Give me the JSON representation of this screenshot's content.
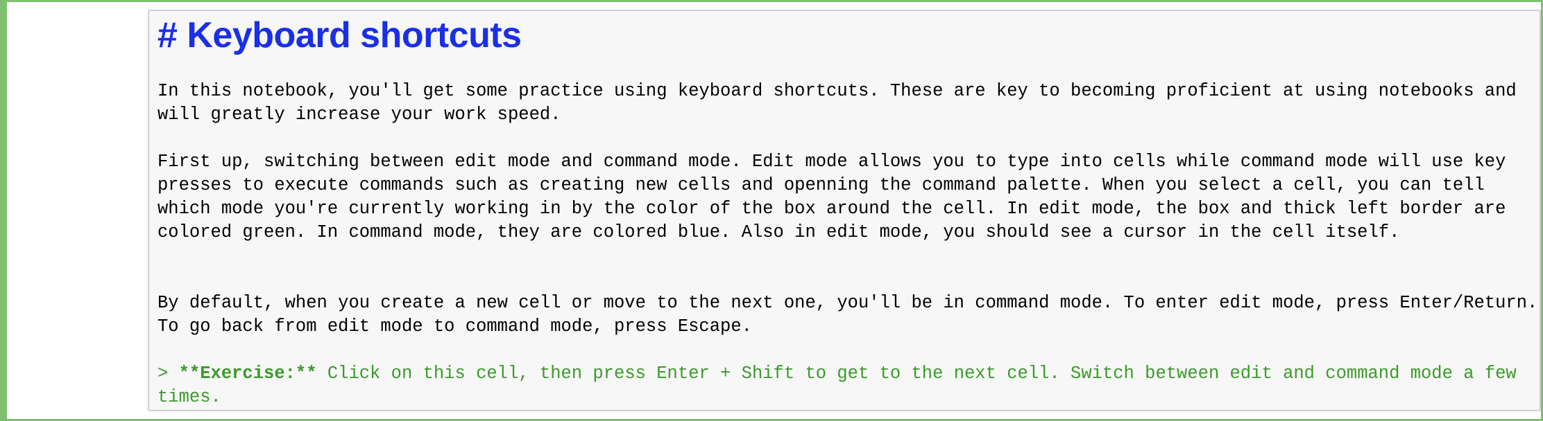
{
  "cell": {
    "heading": "# Keyboard shortcuts",
    "paragraph_1": "In this notebook, you'll get some practice using keyboard shortcuts. These are key to becoming proficient at using notebooks and will greatly increase your work speed.",
    "paragraph_2": "First up, switching between edit mode and command mode. Edit mode allows you to type into cells while command mode will use key presses to execute commands such as creating new cells and openning the command palette. When you select a cell, you can tell which mode you're currently working in by the color of the box around the cell. In edit mode, the box and thick left border are colored green. In command mode, they are colored blue. Also in edit mode, you should see a cursor in the cell itself.",
    "paragraph_3": "By default, when you create a new cell or move to the next one, you'll be in command mode. To enter edit mode, press Enter/Return. To go back from edit mode to command mode, press Escape.",
    "exercise": {
      "prefix": "> ",
      "bold": "**Exercise:**",
      "rest": " Click on this cell, then press Enter + Shift to get to the next cell. Switch between edit and command mode a few times."
    }
  },
  "colors": {
    "edit_border": "#7fbf72",
    "heading": "#1a2fe6",
    "quote": "#3b9a2a",
    "editor_bg": "#f7f7f7"
  }
}
